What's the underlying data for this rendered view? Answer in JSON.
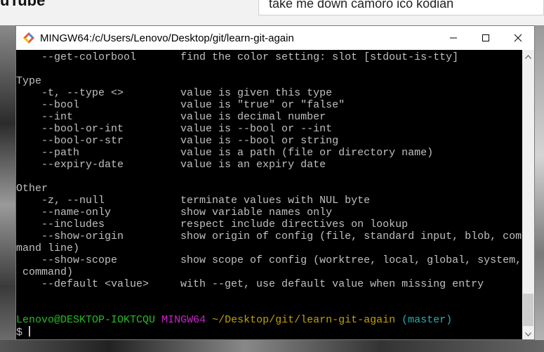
{
  "background": {
    "logo_text": "uTube",
    "search_value": "take me down camoro ico kodian"
  },
  "window": {
    "title": "MINGW64:/c/Users/Lenovo/Desktop/git/learn-git-again",
    "controls": {
      "minimize": "minimize",
      "maximize": "maximize",
      "close": "close"
    }
  },
  "terminal": {
    "lines": [
      "    --get-colorbool       find the color setting: slot [stdout-is-tty]",
      "",
      "Type",
      "    -t, --type <>         value is given this type",
      "    --bool                value is \"true\" or \"false\"",
      "    --int                 value is decimal number",
      "    --bool-or-int         value is --bool or --int",
      "    --bool-or-str         value is --bool or string",
      "    --path                value is a path (file or directory name)",
      "    --expiry-date         value is an expiry date",
      "",
      "Other",
      "    -z, --null            terminate values with NUL byte",
      "    --name-only           show variable names only",
      "    --includes            respect include directives on lookup",
      "    --show-origin         show origin of config (file, standard input, blob, com",
      "mand line)",
      "    --show-scope          show scope of config (worktree, local, global, system,",
      " command)",
      "    --default <value>     with --get, use default value when missing entry",
      "",
      ""
    ],
    "prompt": {
      "user_host": "Lenovo@DESKTOP-IOKTCQU",
      "env": "MINGW64",
      "path": "~/Desktop/git/learn-git-again",
      "branch": "(master)",
      "symbol": "$"
    },
    "colors": {
      "text": "#c0c0c0",
      "user_host": "#1fbf1f",
      "env": "#d11fd1",
      "path": "#c2a000",
      "branch": "#20b2b2"
    }
  }
}
